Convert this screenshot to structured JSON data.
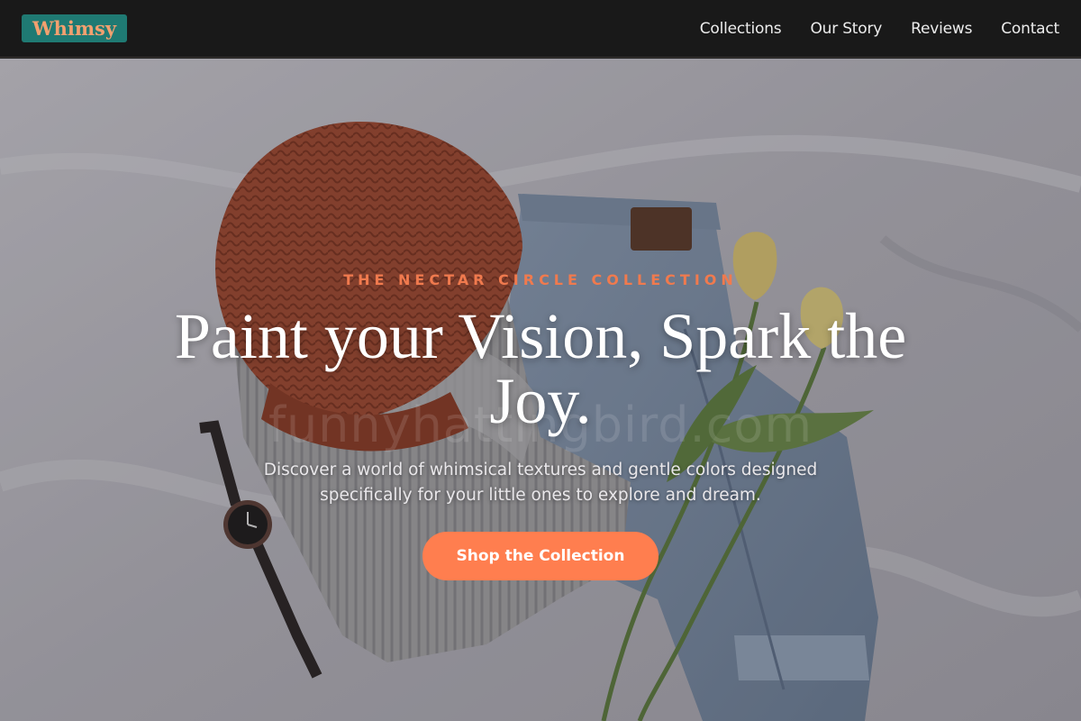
{
  "header": {
    "logo": "Whimsy",
    "nav": [
      "Collections",
      "Our Story",
      "Reviews",
      "Contact"
    ]
  },
  "hero": {
    "eyebrow": "THE NECTAR CIRCLE COLLECTION",
    "headline": "Paint your Vision, Spark the Joy.",
    "subtext": "Discover a world of whimsical textures and gentle colors designed specifically for your little ones to explore and dream.",
    "cta": "Shop the Collection",
    "watermark": "funnyhattingbird.com"
  },
  "colors": {
    "header_bg": "#191919",
    "logo_bg": "#1f7a73",
    "logo_text": "#f3a06f",
    "accent": "#ff7e4f",
    "eyebrow": "#f07a4e"
  },
  "icons": [
    "knit-beanie-photo",
    "wristwatch-photo",
    "denim-jeans-photo",
    "tulip-photo"
  ]
}
